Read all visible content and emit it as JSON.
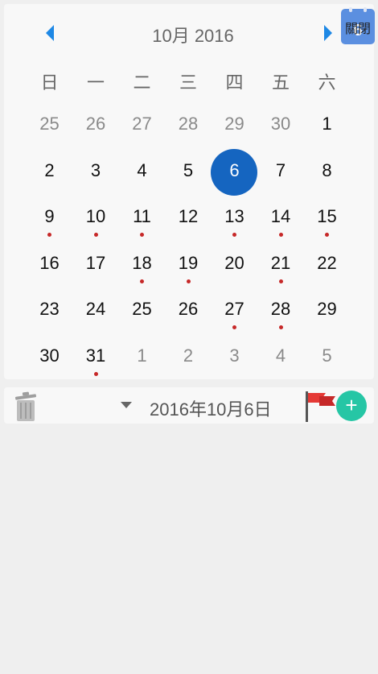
{
  "calendar": {
    "title": "10月 2016",
    "today_button": {
      "day": "6",
      "label": "關閉"
    },
    "weekdays": [
      "日",
      "一",
      "二",
      "三",
      "四",
      "五",
      "六"
    ],
    "weeks": [
      [
        {
          "d": "25",
          "other": true,
          "dot": false
        },
        {
          "d": "26",
          "other": true,
          "dot": false
        },
        {
          "d": "27",
          "other": true,
          "dot": false
        },
        {
          "d": "28",
          "other": true,
          "dot": false
        },
        {
          "d": "29",
          "other": true,
          "dot": false
        },
        {
          "d": "30",
          "other": true,
          "dot": false
        },
        {
          "d": "1",
          "other": false,
          "dot": false
        }
      ],
      [
        {
          "d": "2",
          "other": false,
          "dot": false
        },
        {
          "d": "3",
          "other": false,
          "dot": false
        },
        {
          "d": "4",
          "other": false,
          "dot": false
        },
        {
          "d": "5",
          "other": false,
          "dot": false
        },
        {
          "d": "6",
          "other": false,
          "dot": false,
          "selected": true
        },
        {
          "d": "7",
          "other": false,
          "dot": false
        },
        {
          "d": "8",
          "other": false,
          "dot": false
        }
      ],
      [
        {
          "d": "9",
          "other": false,
          "dot": true
        },
        {
          "d": "10",
          "other": false,
          "dot": true
        },
        {
          "d": "11",
          "other": false,
          "dot": true
        },
        {
          "d": "12",
          "other": false,
          "dot": false
        },
        {
          "d": "13",
          "other": false,
          "dot": true
        },
        {
          "d": "14",
          "other": false,
          "dot": true
        },
        {
          "d": "15",
          "other": false,
          "dot": true
        }
      ],
      [
        {
          "d": "16",
          "other": false,
          "dot": false
        },
        {
          "d": "17",
          "other": false,
          "dot": false
        },
        {
          "d": "18",
          "other": false,
          "dot": true
        },
        {
          "d": "19",
          "other": false,
          "dot": true
        },
        {
          "d": "20",
          "other": false,
          "dot": false
        },
        {
          "d": "21",
          "other": false,
          "dot": true
        },
        {
          "d": "22",
          "other": false,
          "dot": false
        }
      ],
      [
        {
          "d": "23",
          "other": false,
          "dot": false
        },
        {
          "d": "24",
          "other": false,
          "dot": false
        },
        {
          "d": "25",
          "other": false,
          "dot": false
        },
        {
          "d": "26",
          "other": false,
          "dot": false
        },
        {
          "d": "27",
          "other": false,
          "dot": true
        },
        {
          "d": "28",
          "other": false,
          "dot": true
        },
        {
          "d": "29",
          "other": false,
          "dot": false
        }
      ],
      [
        {
          "d": "30",
          "other": false,
          "dot": false
        },
        {
          "d": "31",
          "other": false,
          "dot": true
        },
        {
          "d": "1",
          "other": true,
          "dot": false
        },
        {
          "d": "2",
          "other": true,
          "dot": false
        },
        {
          "d": "3",
          "other": true,
          "dot": false
        },
        {
          "d": "4",
          "other": true,
          "dot": false
        },
        {
          "d": "5",
          "other": true,
          "dot": false
        }
      ]
    ],
    "colors": {
      "selected": "#1565c0",
      "event_dot": "#c62828",
      "nav_arrow": "#1e88e5"
    }
  },
  "toolbar": {
    "date_label": "2016年10月6日",
    "icons": [
      "trash-icon",
      "caret-down-icon",
      "flag-icon",
      "plus-icon"
    ],
    "add_color": "#26c6a5"
  }
}
